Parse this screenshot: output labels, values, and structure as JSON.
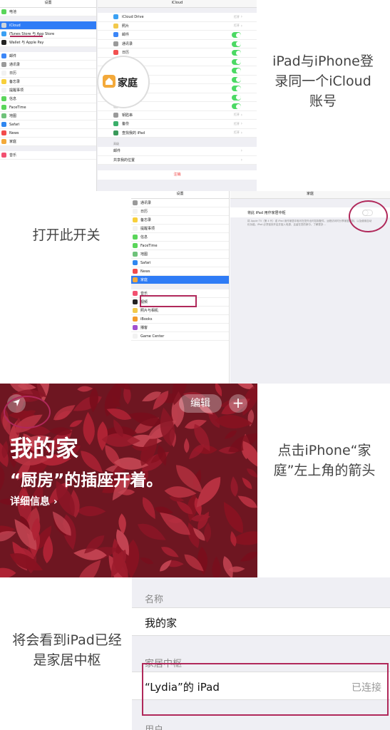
{
  "captions": {
    "step1": "iPad与iPhone登录同一个iCloud账号",
    "step2": "打开此开关",
    "step3": "点击iPhone“家庭”左上角的箭头",
    "step4": "将会看到iPad已经是家居中枢"
  },
  "panel1": {
    "left_title": "设置",
    "right_title": "iCloud",
    "left_top_item": "电池",
    "left_items": [
      {
        "label": "iCloud",
        "color": "#cfd4da",
        "selected": true
      },
      {
        "label": "iTunes Store 与 App Store",
        "color": "#3aa0f3"
      },
      {
        "label": "Wallet 与 Apple Pay",
        "color": "#222222"
      },
      {
        "label": "邮件",
        "color": "#3b86f7",
        "gap_before": true
      },
      {
        "label": "通讯录",
        "color": "#9a9a9a"
      },
      {
        "label": "日历",
        "color": "#f2f2f2"
      },
      {
        "label": "备忘录",
        "color": "#f7cf3b"
      },
      {
        "label": "提醒事项",
        "color": "#f2f2f2"
      },
      {
        "label": "信息",
        "color": "#5ad55a"
      },
      {
        "label": "FaceTime",
        "color": "#5ad55a"
      },
      {
        "label": "地图",
        "color": "#6fc27a"
      },
      {
        "label": "Safari",
        "color": "#2f87f0"
      },
      {
        "label": "News",
        "color": "#f24b4b"
      },
      {
        "label": "家庭",
        "color": "#f3a93a"
      },
      {
        "label": "音乐",
        "color": "#f25070",
        "gap_before": true
      }
    ],
    "right_items": [
      {
        "label": "iCloud Drive",
        "color": "#3aa0f3",
        "value": "打开"
      },
      {
        "label": "照片",
        "color": "#f2c94c",
        "value": "打开"
      },
      {
        "label": "邮件",
        "color": "#3b86f7",
        "toggle": true
      },
      {
        "label": "通讯录",
        "color": "#9a9a9a",
        "toggle": true
      },
      {
        "label": "日历",
        "color": "#f25050",
        "toggle": true
      },
      {
        "label": "",
        "toggle": true
      },
      {
        "label": "",
        "toggle": true
      },
      {
        "label": "",
        "toggle": true
      },
      {
        "label": "",
        "toggle": true
      },
      {
        "label": "",
        "toggle": true
      },
      {
        "label": "",
        "toggle": true
      },
      {
        "label": "钥匙串",
        "color": "#9a9a9a",
        "value": "打开"
      },
      {
        "label": "备份",
        "color": "#3aaf6a",
        "value": "打开"
      },
      {
        "label": "查找我的 iPad",
        "color": "#3a9a5a",
        "value": "打开"
      }
    ],
    "advanced_header": "高级",
    "advanced_items": [
      "邮件",
      "共享我的位置"
    ],
    "signout": "注销",
    "home_zoom_label": "家庭"
  },
  "panel2": {
    "left_title": "设置",
    "right_title": "家庭",
    "left_items": [
      {
        "label": "通讯录",
        "color": "#9a9a9a"
      },
      {
        "label": "日历",
        "color": "#f2f2f2"
      },
      {
        "label": "备忘录",
        "color": "#f7cf3b"
      },
      {
        "label": "提醒事项",
        "color": "#f2f2f2"
      },
      {
        "label": "信息",
        "color": "#5ad55a"
      },
      {
        "label": "FaceTime",
        "color": "#5ad55a"
      },
      {
        "label": "地图",
        "color": "#6fc27a"
      },
      {
        "label": "Safari",
        "color": "#2f87f0"
      },
      {
        "label": "News",
        "color": "#f24b4b"
      },
      {
        "label": "家庭",
        "color": "#f3a93a",
        "selected": true
      },
      {
        "label": "音乐",
        "color": "#f25070",
        "gap_before": true
      },
      {
        "label": "视频",
        "color": "#222222"
      },
      {
        "label": "照片与相机",
        "color": "#f2c94c"
      },
      {
        "label": "iBooks",
        "color": "#f39a2a"
      },
      {
        "label": "播客",
        "color": "#a050d0"
      },
      {
        "label": "Game Center",
        "color": "#f2f2f2"
      }
    ],
    "setting_label": "将此 iPad 用作家居中枢",
    "setting_desc": "将 Apple TV（第 4 代）或 iPad 用作家居中枢可在您外出时控制配件，远程访问时分享家庭控制，以及使用自动化功能。iPad 必须保持开启并接入电源，且留在您的家中。了解更多…"
  },
  "panel3": {
    "edit_label": "编辑",
    "add_label": "+",
    "home_title": "我的家",
    "status_line": "“厨房”的插座开着。",
    "details_link": "详细信息"
  },
  "panel4": {
    "name_header": "名称",
    "name_value": "我的家",
    "hub_header": "家居中枢",
    "hub_device": "“Lydia”的 iPad",
    "hub_status": "已连接",
    "users_header": "用户"
  },
  "colors": {
    "accent_blue": "#2f7cf6",
    "toggle_green": "#4cd964",
    "highlight_magenta": "#b0285a",
    "leaf_red": "#a81e30"
  }
}
